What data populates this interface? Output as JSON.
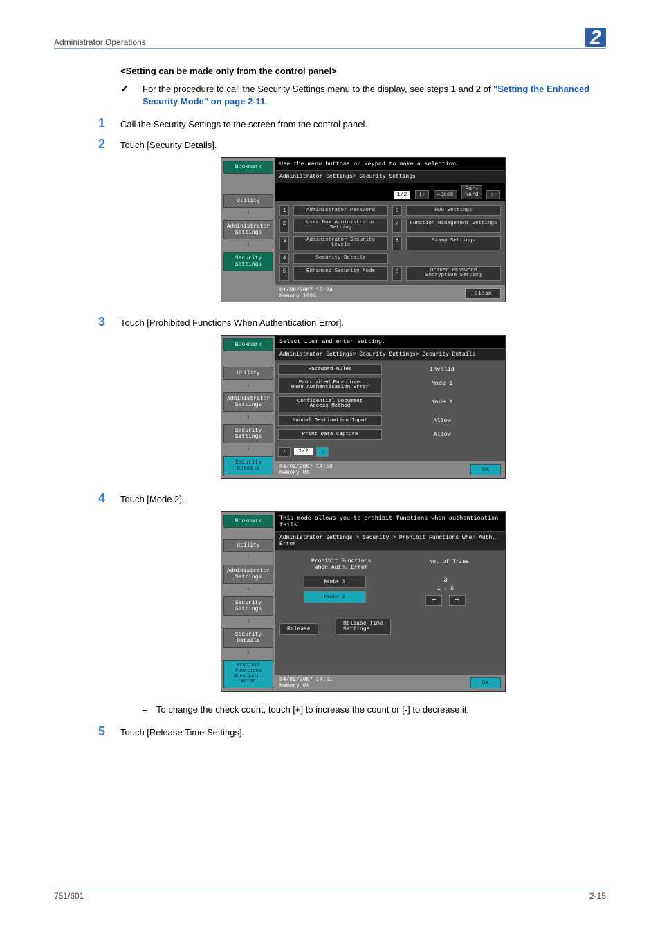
{
  "header": {
    "title": "Administrator Operations",
    "chapter": "2"
  },
  "subhead": "<Setting can be made only from the control panel>",
  "bullet_check": {
    "mark": "✔",
    "text_a": "For the procedure to call the Security Settings menu to the display, see steps 1 and 2 of ",
    "link": "\"Setting the Enhanced Security Mode\" on page 2-11",
    "text_b": "."
  },
  "steps": {
    "s1": {
      "n": "1",
      "t": "Call the Security Settings to the screen from the control panel."
    },
    "s2": {
      "n": "2",
      "t": "Touch [Security Details]."
    },
    "s3": {
      "n": "3",
      "t": "Touch [Prohibited Functions When Authentication Error]."
    },
    "s4": {
      "n": "4",
      "t": "Touch [Mode 2]."
    },
    "s5": {
      "n": "5",
      "t": "Touch [Release Time Settings]."
    }
  },
  "dash_note": "To change the check count, touch [+] to increase the count or [-] to decrease it.",
  "screen1": {
    "top": "Use the menu buttons or keypad to make a selection.",
    "breadcrumb": "Administrator Settings> Security Settings",
    "page": "1/2",
    "back": "←Back",
    "fwd": "For-\nward",
    "side": {
      "bookmark": "Bookmark",
      "utility": "Utility",
      "admin": "Administrator\nSettings",
      "security": "Security\nSettings"
    },
    "menu": [
      {
        "n": "1",
        "l": "Administrator Password"
      },
      {
        "n": "2",
        "l": "User Box Administrator\nSetting"
      },
      {
        "n": "3",
        "l": "Administrator Security\nLevels"
      },
      {
        "n": "4",
        "l": "Security Details"
      },
      {
        "n": "5",
        "l": "Enhanced Security Mode"
      },
      {
        "n": "6",
        "l": "HDD Settings"
      },
      {
        "n": "7",
        "l": "Function Management Settings"
      },
      {
        "n": "8",
        "l": "Stamp Settings"
      },
      {
        "n": "0",
        "l": "Driver Password\nEncryption Setting"
      }
    ],
    "foot_date": "01/06/2007   15:24",
    "foot_mem": "Memory      100%",
    "close": "Close"
  },
  "screen2": {
    "top": "Select item and enter setting.",
    "breadcrumb": "Administrator Settings> Security Settings> Security Details",
    "side": {
      "bookmark": "Bookmark",
      "utility": "Utility",
      "admin": "Administrator\nSettings",
      "security": "Security\nSettings",
      "details": "Security Details"
    },
    "rows": [
      {
        "l": "Password Rules",
        "v": "Invalid"
      },
      {
        "l": "Prohibited Functions\nWhen Authentication Error",
        "v": "Mode 1"
      },
      {
        "l": "Confidential Document\nAccess Method",
        "v": "Mode 1"
      },
      {
        "l": "Manual Destination Input",
        "v": "Allow"
      },
      {
        "l": "Print Data Capture",
        "v": "Allow"
      }
    ],
    "page": "1/2",
    "foot_date": "04/02/2007   14:50",
    "foot_mem": "Memory       0%",
    "ok": "OK"
  },
  "screen3": {
    "top": "This mode allows you to prohibit functions when authentication fails.",
    "breadcrumb": "Administrator Settings > Security > Prohibit Functions When Auth. Error",
    "side": {
      "bookmark": "Bookmark",
      "utility": "Utility",
      "admin": "Administrator\nSettings",
      "security": "Security\nSettings",
      "details": "Security Details",
      "prohibit": "Prohibit\nFunctions\nWhen Auth. Error"
    },
    "col1": "Prohibit Functions\nWhen Auth. Error",
    "col2": "No. of Tries",
    "mode1": "Mode 1",
    "mode2": "Mode 2",
    "tries": "3",
    "range": "1  -  5",
    "minus": "−",
    "plus": "+",
    "release": "Release",
    "release_time": "Release Time\nSettings",
    "foot_date": "04/02/2007   14:51",
    "foot_mem": "Memory       0%",
    "ok": "OK"
  },
  "footer": {
    "left": "751/601",
    "right": "2-15"
  }
}
